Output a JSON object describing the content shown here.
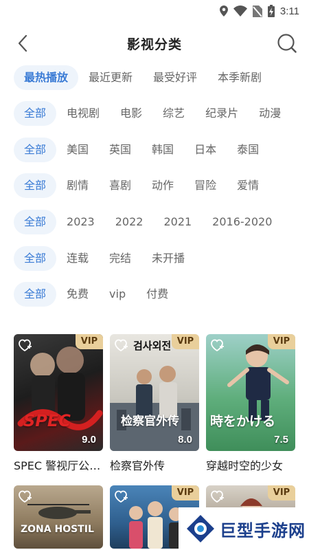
{
  "status": {
    "time": "3:11"
  },
  "header": {
    "title": "影视分类"
  },
  "sort_tabs": [
    {
      "label": "最热播放",
      "active": true
    },
    {
      "label": "最近更新",
      "active": false
    },
    {
      "label": "最受好评",
      "active": false
    },
    {
      "label": "本季新剧",
      "active": false
    }
  ],
  "filters": {
    "type": [
      "全部",
      "电视剧",
      "电影",
      "综艺",
      "纪录片",
      "动漫"
    ],
    "region": [
      "全部",
      "美国",
      "英国",
      "韩国",
      "日本",
      "泰国"
    ],
    "genre": [
      "全部",
      "剧情",
      "喜剧",
      "动作",
      "冒险",
      "爱情"
    ],
    "year": [
      "全部",
      "2023",
      "2022",
      "2021",
      "2016-2020"
    ],
    "status": [
      "全部",
      "连载",
      "完结",
      "未开播"
    ],
    "fee": [
      "全部",
      "免费",
      "vip",
      "付费"
    ]
  },
  "cards": [
    {
      "title": "SPEC 警视厅公安部公安第五课",
      "vip": "VIP",
      "score": "9.0",
      "art": "SPEC"
    },
    {
      "title": "检察官外传",
      "vip": "VIP",
      "score": "8.0",
      "art": "检察官外传",
      "art_top": "검사외전"
    },
    {
      "title": "穿越时空的少女",
      "vip": "VIP",
      "score": "7.5",
      "art": "時をかける"
    },
    {
      "title": "",
      "vip": "",
      "score": "",
      "art": "ZONA HOSTIL"
    },
    {
      "title": "",
      "vip": "VIP",
      "score": "",
      "art": ""
    },
    {
      "title": "",
      "vip": "VIP",
      "score": "",
      "art": ""
    }
  ],
  "watermark": {
    "text": "巨型手游网"
  },
  "colors": {
    "accent": "#3a7bd5",
    "chip_bg": "#eef4fb",
    "vip_bg": "#e9cf9b",
    "vip_text": "#5b3b10"
  }
}
